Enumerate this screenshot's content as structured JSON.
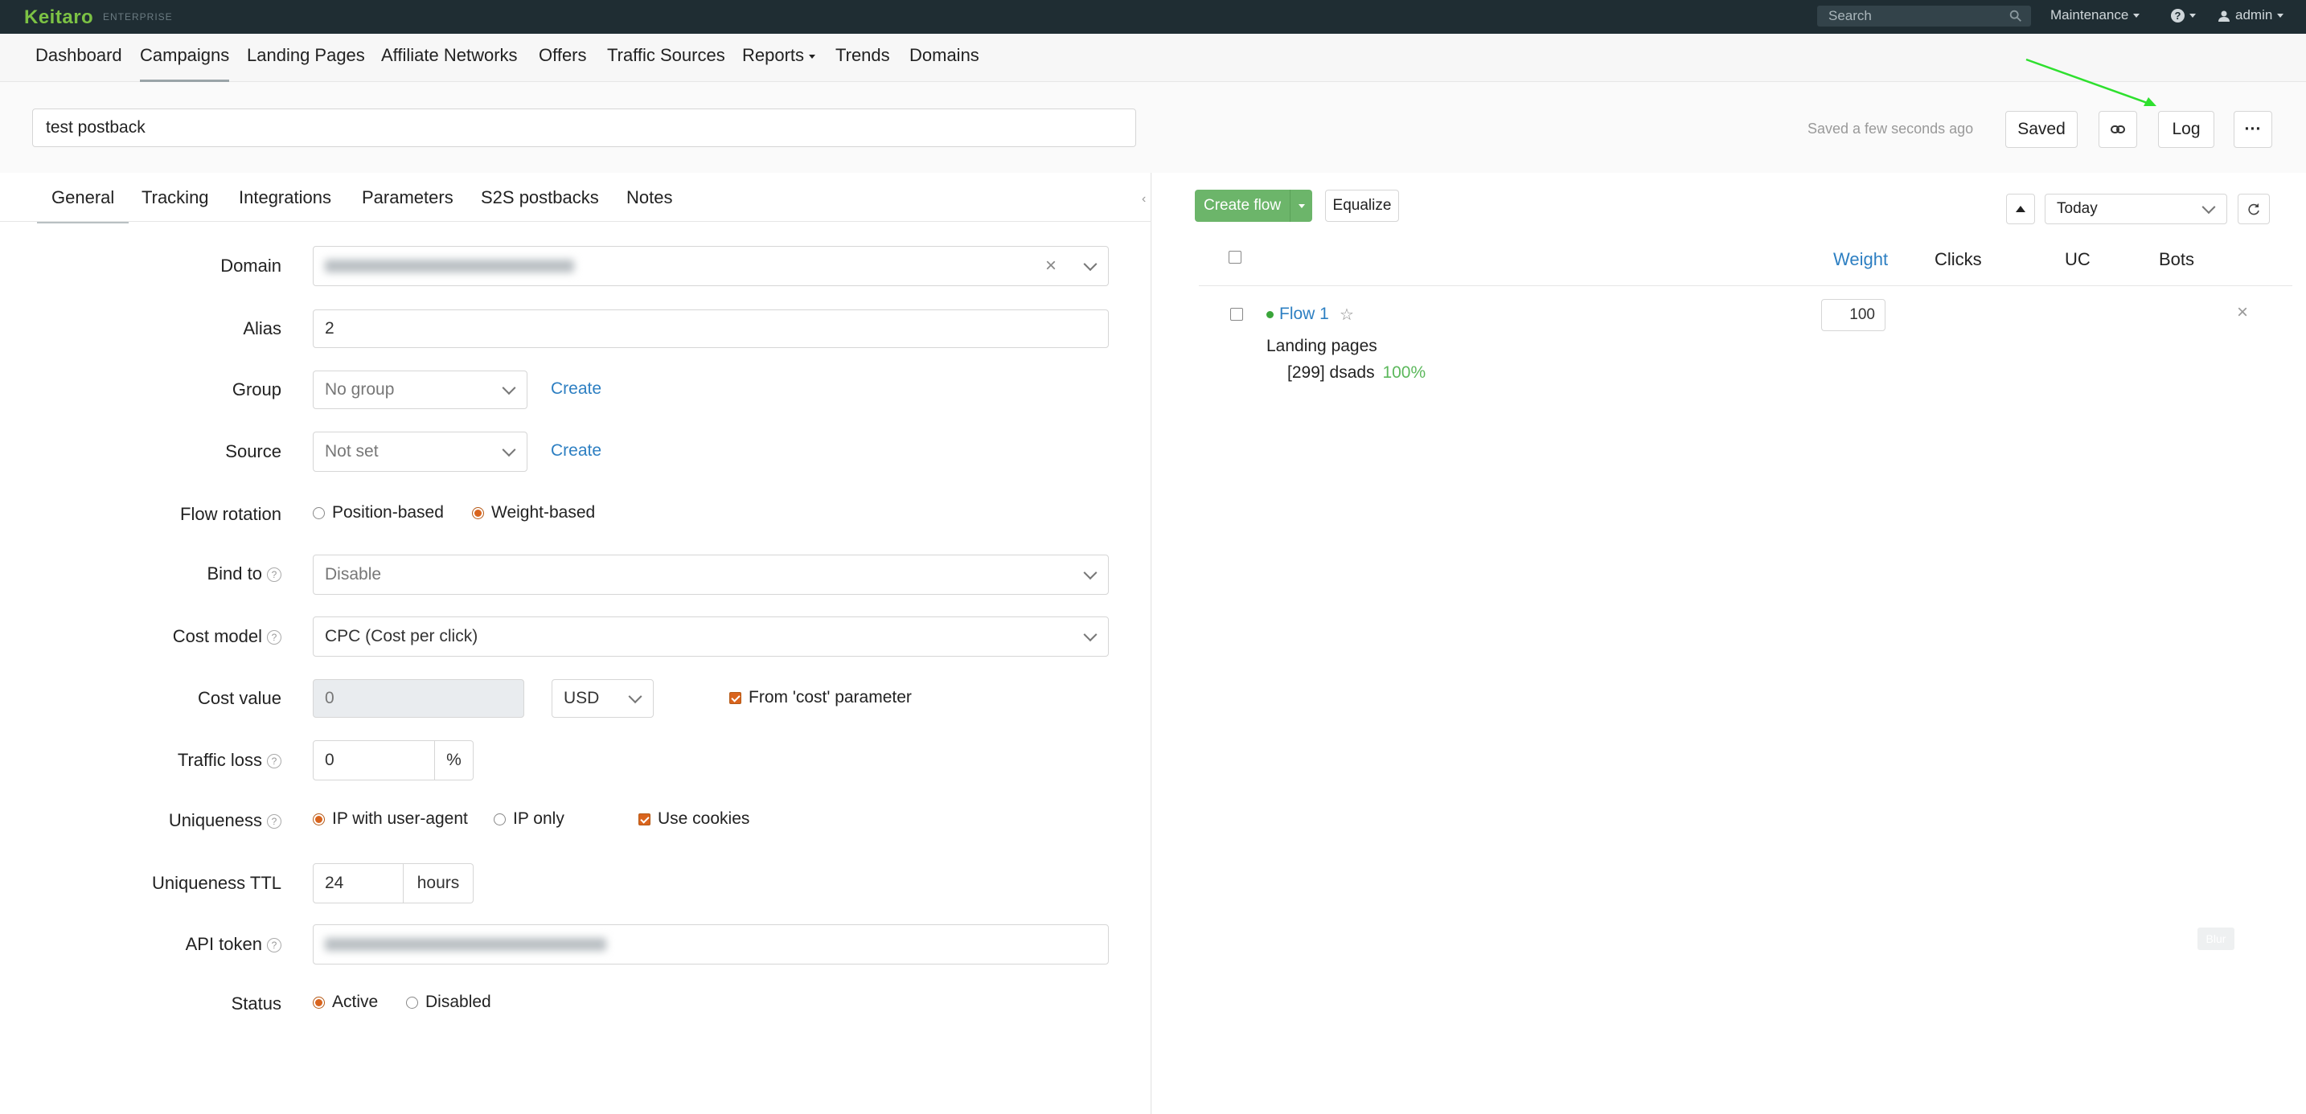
{
  "topbar": {
    "logo": "Keitaro",
    "edition": "ENTERPRISE",
    "search_placeholder": "Search",
    "maintenance": "Maintenance",
    "help": "?",
    "user": "admin"
  },
  "nav": {
    "items": [
      "Dashboard",
      "Campaigns",
      "Landing Pages",
      "Affiliate Networks",
      "Offers",
      "Traffic Sources",
      "Reports",
      "Trends",
      "Domains"
    ]
  },
  "header": {
    "campaign_name": "test postback",
    "saved_status": "Saved a few seconds ago",
    "saved_button": "Saved",
    "log_button": "Log",
    "more_button": "···"
  },
  "tabs": [
    "General",
    "Tracking",
    "Integrations",
    "Parameters",
    "S2S postbacks",
    "Notes"
  ],
  "form": {
    "domain_label": "Domain",
    "alias_label": "Alias",
    "alias_value": "2",
    "group_label": "Group",
    "group_value": "No group",
    "group_create": "Create",
    "source_label": "Source",
    "source_value": "Not set",
    "source_create": "Create",
    "flow_rotation_label": "Flow rotation",
    "flow_rotation_options": [
      "Position-based",
      "Weight-based"
    ],
    "bind_to_label": "Bind to",
    "bind_to_value": "Disable",
    "cost_model_label": "Cost model",
    "cost_model_value": "CPC (Cost per click)",
    "cost_value_label": "Cost value",
    "cost_value": "0",
    "currency": "USD",
    "from_cost_param": "From 'cost' parameter",
    "traffic_loss_label": "Traffic loss",
    "traffic_loss_value": "0",
    "traffic_loss_unit": "%",
    "uniqueness_label": "Uniqueness",
    "uniqueness_options": [
      "IP with user-agent",
      "IP only"
    ],
    "use_cookies": "Use cookies",
    "uniqueness_ttl_label": "Uniqueness TTL",
    "uniqueness_ttl_value": "24",
    "uniqueness_ttl_unit": "hours",
    "api_token_label": "API token",
    "status_label": "Status",
    "status_options": [
      "Active",
      "Disabled"
    ]
  },
  "flows": {
    "create_flow": "Create flow",
    "equalize": "Equalize",
    "period": "Today",
    "columns": [
      "Weight",
      "Clicks",
      "UC",
      "Bots"
    ],
    "items": [
      {
        "name": "Flow 1",
        "weight": "100",
        "section": "Landing pages",
        "landing": "[299] dsads",
        "share": "100%"
      }
    ],
    "blur_badge": "Blur"
  },
  "colors": {
    "accent_green": "#7cc244",
    "button_green": "#6cb56a",
    "link_blue": "#2d7fc2",
    "radio_orange": "#d9641d",
    "arrow_green": "#2ee02e"
  }
}
